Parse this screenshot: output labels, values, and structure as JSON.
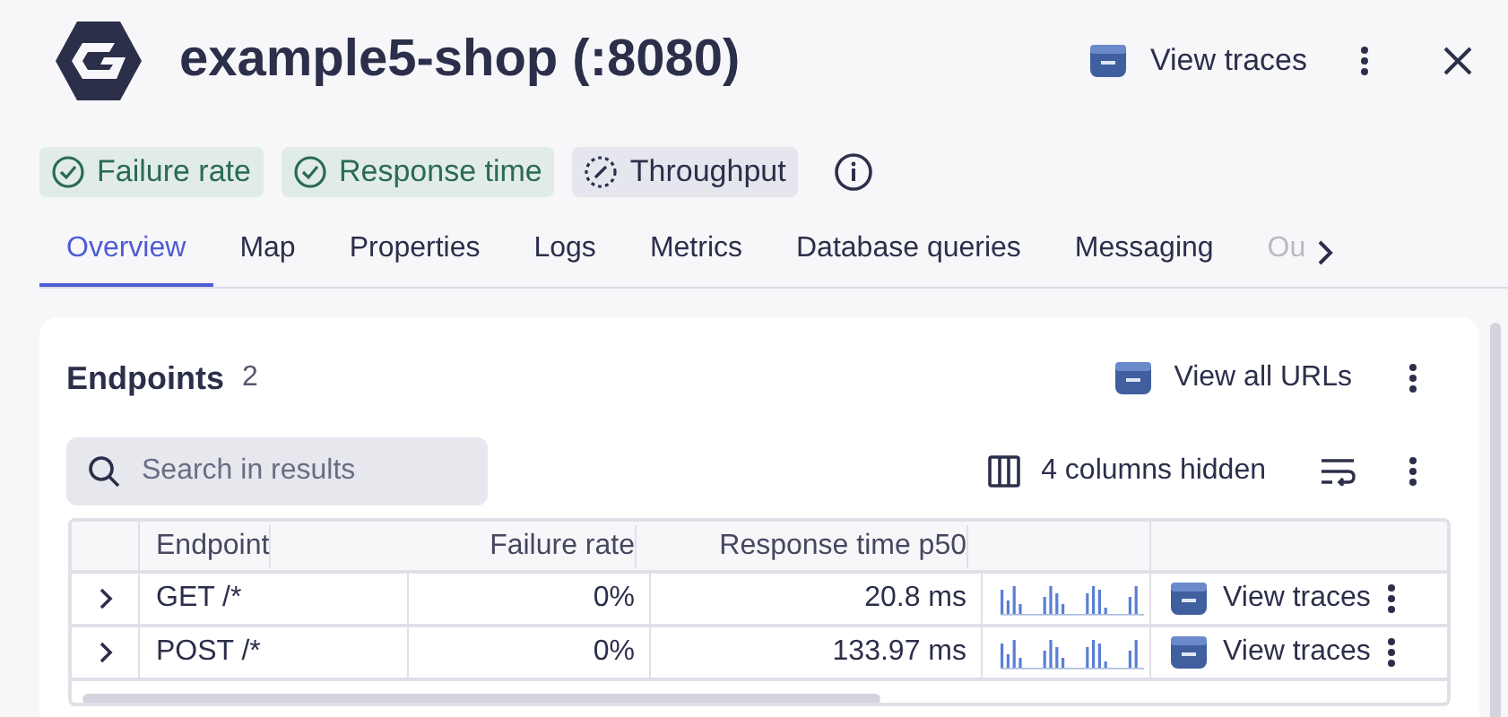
{
  "header": {
    "title": "example5-shop (:8080)",
    "action": "View traces"
  },
  "chips": [
    {
      "kind": "ok",
      "label": "Failure rate"
    },
    {
      "kind": "ok",
      "label": "Response time"
    },
    {
      "kind": "pending",
      "label": "Throughput"
    }
  ],
  "tabs": [
    {
      "label": "Overview",
      "selected": true
    },
    {
      "label": "Map",
      "selected": false
    },
    {
      "label": "Properties",
      "selected": false
    },
    {
      "label": "Logs",
      "selected": false
    },
    {
      "label": "Metrics",
      "selected": false
    },
    {
      "label": "Database queries",
      "selected": false
    },
    {
      "label": "Messaging",
      "selected": false
    },
    {
      "label": "Ou",
      "selected": false,
      "faded": true
    }
  ],
  "endpoints": {
    "title": "Endpoints",
    "count": "2",
    "action": "View all URLs",
    "search": {
      "placeholder": "Search in results"
    },
    "hidden_columns": "4 columns hidden",
    "table": {
      "columns": [
        "Endpoint",
        "Failure rate",
        "Response time p50"
      ],
      "rows": [
        {
          "endpoint": "GET /*",
          "failure_rate": "0%",
          "response_time": "20.8 ms",
          "action": "View traces",
          "expanded": false
        },
        {
          "endpoint": "POST /*",
          "failure_rate": "0%",
          "response_time": "133.97 ms",
          "action": "View traces",
          "expanded": false
        }
      ]
    }
  }
}
